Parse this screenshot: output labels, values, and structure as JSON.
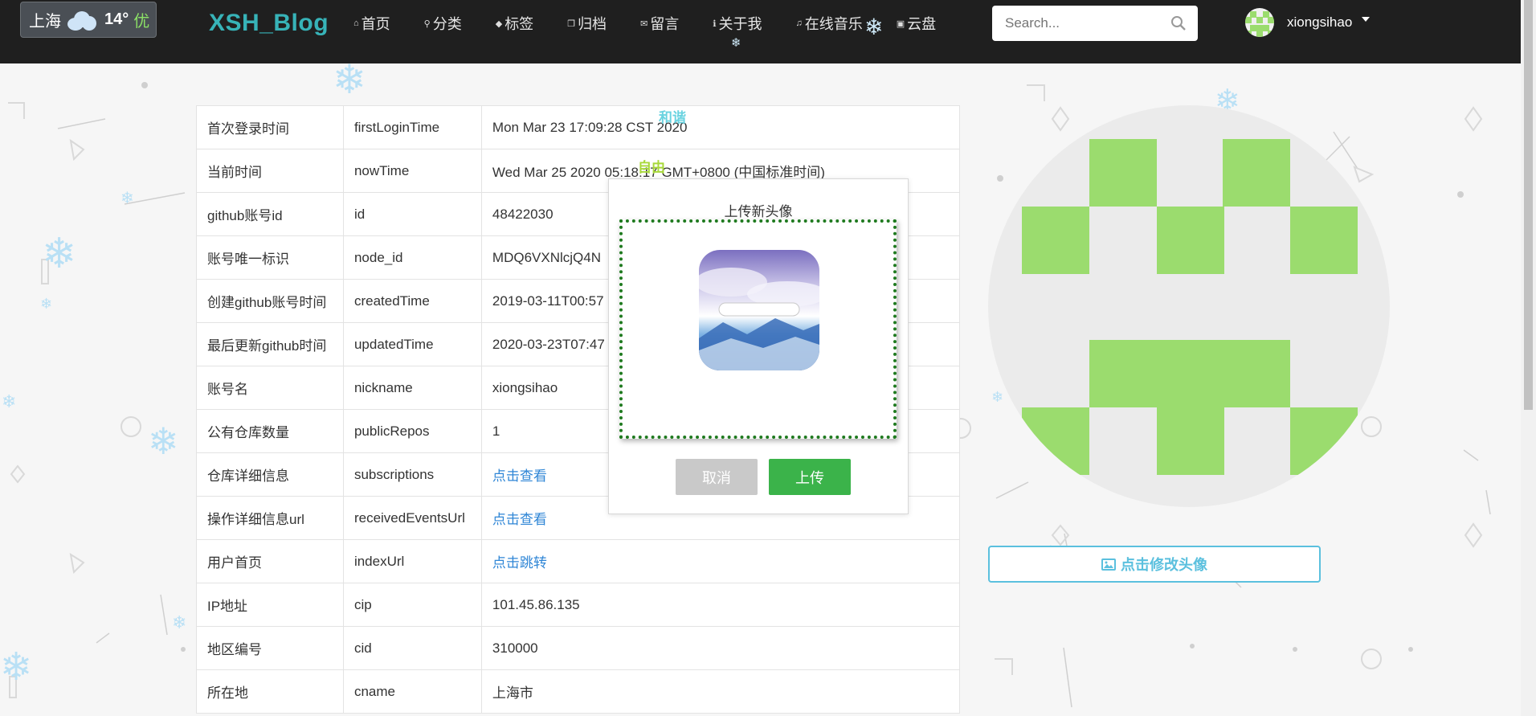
{
  "weather": {
    "city": "上海",
    "temp": "14°",
    "aqi": "优",
    "icon": "cloud-icon"
  },
  "brand": "XSH_Blog",
  "nav": [
    {
      "icon": "home-icon",
      "glyph": "⌂",
      "label": "首页"
    },
    {
      "icon": "pin-icon",
      "glyph": "⚲",
      "label": "分类"
    },
    {
      "icon": "tag-icon",
      "glyph": "◆",
      "label": "标签"
    },
    {
      "icon": "archive-icon",
      "glyph": "❐",
      "label": "归档"
    },
    {
      "icon": "mail-icon",
      "glyph": "✉",
      "label": "留言"
    },
    {
      "icon": "info-icon",
      "glyph": "ℹ",
      "label": "关于我"
    },
    {
      "icon": "music-icon",
      "glyph": "♫",
      "label": "在线音乐"
    },
    {
      "icon": "disk-icon",
      "glyph": "▣",
      "label": "云盘"
    }
  ],
  "search": {
    "placeholder": "Search..."
  },
  "user": {
    "name": "xiongsihao"
  },
  "table": [
    {
      "label": "首次登录时间",
      "key": "firstLoginTime",
      "value": "Mon Mar 23 17:09:28 CST 2020"
    },
    {
      "label": "当前时间",
      "key": "nowTime",
      "value": "Wed Mar 25 2020 05:18:17 GMT+0800 (中国标准时间)"
    },
    {
      "label": "github账号id",
      "key": "id",
      "value": "48422030"
    },
    {
      "label": "账号唯一标识",
      "key": "node_id",
      "value": "MDQ6VXNlcjQ4N"
    },
    {
      "label": "创建github账号时间",
      "key": "createdTime",
      "value": "2019-03-11T00:57"
    },
    {
      "label": "最后更新github时间",
      "key": "updatedTime",
      "value": "2020-03-23T07:47"
    },
    {
      "label": "账号名",
      "key": "nickname",
      "value": "xiongsihao"
    },
    {
      "label": "公有仓库数量",
      "key": "publicRepos",
      "value": "1"
    },
    {
      "label": "仓库详细信息",
      "key": "subscriptions",
      "value": "点击查看",
      "link": true
    },
    {
      "label": "操作详细信息url",
      "key": "receivedEventsUrl",
      "value": "点击查看",
      "link": true
    },
    {
      "label": "用户首页",
      "key": "indexUrl",
      "value": "点击跳转",
      "link": true
    },
    {
      "label": "IP地址",
      "key": "cip",
      "value": "101.45.86.135"
    },
    {
      "label": "地区编号",
      "key": "cid",
      "value": "310000"
    },
    {
      "label": "所在地",
      "key": "cname",
      "value": "上海市"
    }
  ],
  "floating": {
    "hexie": "和谐",
    "ziyou": "自由",
    "hexie_color": "#6ad3e0",
    "ziyou_color": "#a8d83a"
  },
  "modal": {
    "title": "上传新头像",
    "cancel": "取消",
    "upload": "上传"
  },
  "avatar_button": "点击修改头像",
  "colors": {
    "navbar": "#1f1f1f",
    "brand": "#37b3b8",
    "avatar_green": "#9bdc6e",
    "upload_green": "#3bb34a",
    "link": "#2f86d6",
    "accent_blue": "#5bc0de"
  }
}
